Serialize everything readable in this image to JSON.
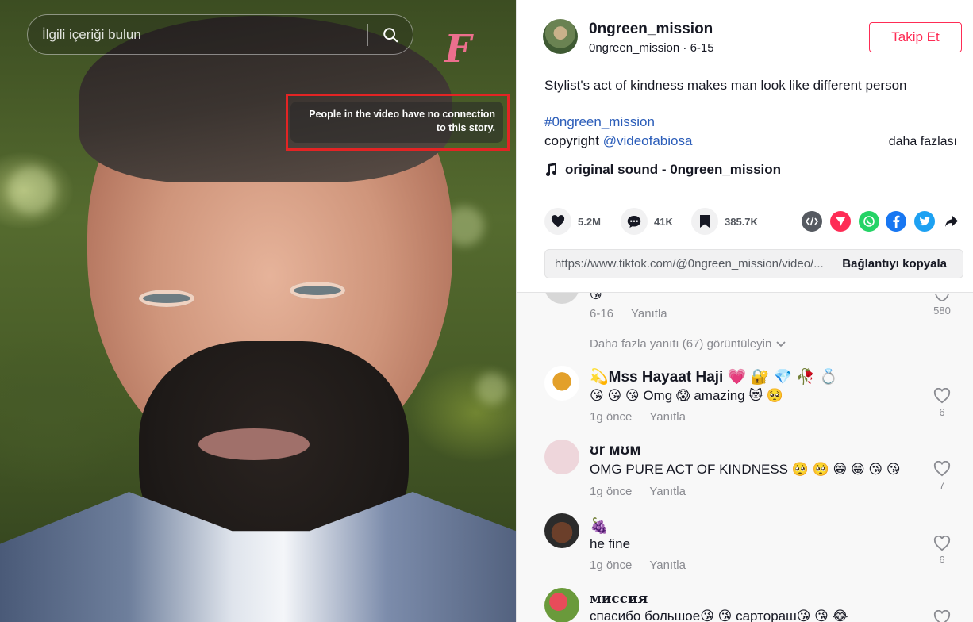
{
  "search": {
    "placeholder": "İlgili içeriği bulun"
  },
  "video": {
    "watermark": "F",
    "disclaimer_line1": "People in the video have no connection",
    "disclaimer_line2": "to this story."
  },
  "post": {
    "username": "0ngreen_mission",
    "subline": "0ngreen_mission · 6-15",
    "follow_label": "Takip Et",
    "description": "Stylist's act of kindness makes man look like different person",
    "hashtag": "#0ngreen_mission",
    "copyright_prefix": "copyright ",
    "copyright_mention": "@videofabiosa",
    "more_label": "daha fazlası",
    "sound": "original sound - 0ngreen_mission"
  },
  "stats": {
    "likes": "5.2M",
    "comments": "41K",
    "bookmarks": "385.7K"
  },
  "share_icons": [
    "embed-icon",
    "send-icon",
    "whatsapp-icon",
    "facebook-icon",
    "twitter-icon",
    "share-arrow-icon"
  ],
  "link": {
    "url": "https://www.tiktok.com/@0ngreen_mission/video/...",
    "copy_label": "Bağlantıyı kopyala"
  },
  "comments": {
    "partial": {
      "date": "6-16",
      "reply": "Yanıtla",
      "likes": "580"
    },
    "view_more": "Daha fazla yanıtı (67) görüntüleyin",
    "items": [
      {
        "name": "💫Mss Hayaat Haji 💗 🔐 💎 🥀 💍",
        "text": "😘 😘 😘 Omg 😱 amazing 😻 🥺",
        "time": "1g önce",
        "reply": "Yanıtla",
        "likes": "6"
      },
      {
        "name": "ʊr мʊм",
        "text": "OMG PURE ACT OF KINDNESS 🥺 🥺 😁 😁 😘 😘",
        "time": "1g önce",
        "reply": "Yanıtla",
        "likes": "7"
      },
      {
        "name": "🍇",
        "text": "he fine",
        "time": "1g önce",
        "reply": "Yanıtla",
        "likes": "6"
      },
      {
        "name": "миссия",
        "text": "спасибо большое😘 😘 сартораш😘 😘 😂",
        "time": "",
        "reply": "",
        "likes": ""
      }
    ]
  },
  "colors": {
    "accent": "#fe2c55",
    "link": "#2b5db9",
    "disclaimer_border": "#e32424"
  }
}
